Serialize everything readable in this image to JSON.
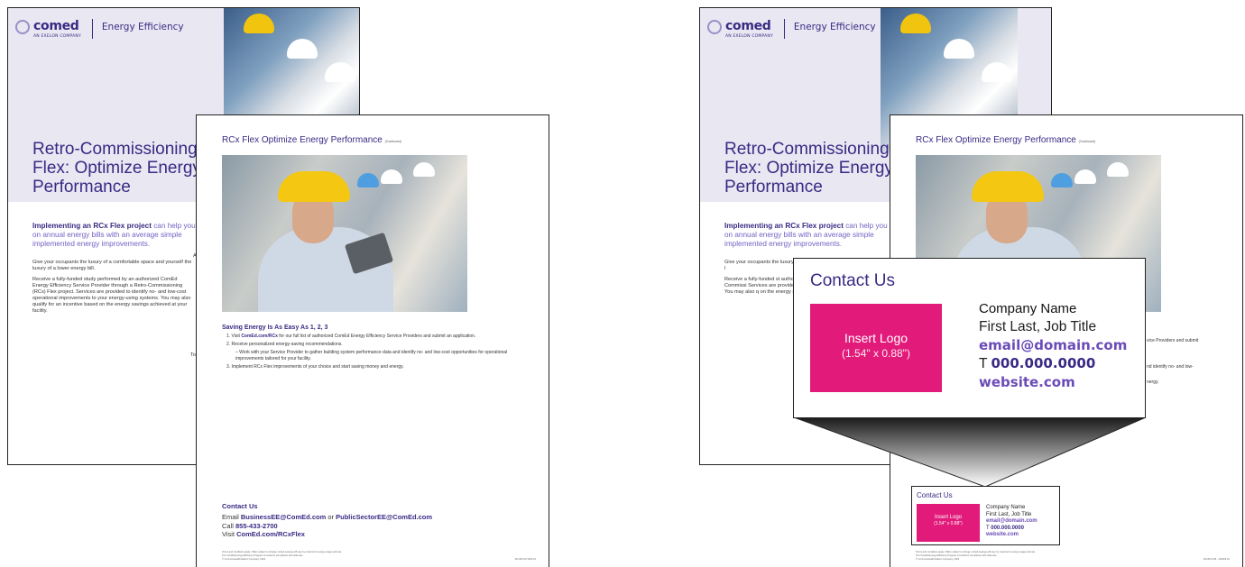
{
  "brand": {
    "wordmark": "comed",
    "tagline": "AN EXELON COMPANY",
    "program": "Energy Efficiency"
  },
  "front": {
    "title_lines": [
      "Retro-Commissioning",
      "Flex: Optimize Energy",
      "Performance"
    ],
    "lead_bold": "Implementing an RCx Flex project",
    "lead_rest": " can help you",
    "lead_line2": "on annual energy bills with an average simple",
    "lead_line3": "implemented energy improvements.",
    "body_p1": "Give your occupants the luxury of a comfortable space and yourself the luxury of a lower energy bill.",
    "body_p2": "Receive a fully-funded study performed by an authorized ComEd Energy Efficiency Service Provider through a Retro-Commissioning (RCx) Flex project. Services are provided to identify no- and low-cost operational improvements to your energy-using systems. You may also qualify for an incentive based on the energy savings achieved at your facility.",
    "right_col_stub": "Ar",
    "right_col_stub2": "To",
    "right_body_p1": "Give your occupants the luxury of a comfortable space and yourself the l",
    "right_body_p2": "Receive a fully-funded st authorized ComEd Energ through a Retro-Commissi Services are provided to i operational improvement systems. You may also q on the energy savings ach"
  },
  "inner": {
    "title": "RCx Flex Optimize Energy Performance",
    "title_note": "(Continued)",
    "saving_heading": "Saving Energy Is As Easy As 1, 2, 3",
    "step1_prefix": "1. Visit ",
    "step1_link": "ComEd.com/RCx",
    "step1_rest": " for our full list of authorized ComEd Energy Efficiency Service Providers and submit an application.",
    "step2": "2. Receive personalized energy-saving recommendations.",
    "step2_sub": "– Work with your Service Provider to gather building system performance data and identify no- and low-cost opportunities for operational improvements tailored for your facility.",
    "step3": "3. Implement RCx Flex improvements of your choice and start saving money and energy.",
    "contact_heading": "Contact Us",
    "email_label": "Email ",
    "email1": "BusinessEE@ComEd.com",
    "email_or": " or ",
    "email2": "PublicSectorEE@ComEd.com",
    "call_label": "Call ",
    "phone": "855-433-2700",
    "visit_label": "Visit ",
    "site": "ComEd.com/RCxFlex",
    "legal1": "Terms and conditions apply. Offers subject to change. Actual savings will vary by customer's energy usage and rate.",
    "legal2": "The ComEd Energy Efficiency Program is funded in compliance with state law.",
    "legal3": "© Commonwealth Edison Company, 2023",
    "code_left": "RCxFFS-071523-01",
    "code_right": "RCxFFS-CB - 102023-01"
  },
  "right_inner_stubs": {
    "s1": "vice Providers and submit",
    "s2": "nd identify no- and low-",
    "s3": "nergy."
  },
  "callout": {
    "heading": "Contact Us",
    "logo_line1": "Insert Logo",
    "logo_line2": "(1.54\" x 0.88\")",
    "company": "Company Name",
    "person": "First Last, Job Title",
    "email": "email@domain.com",
    "tel_prefix": "T ",
    "tel": "000.000.0000",
    "website": "website.com"
  }
}
